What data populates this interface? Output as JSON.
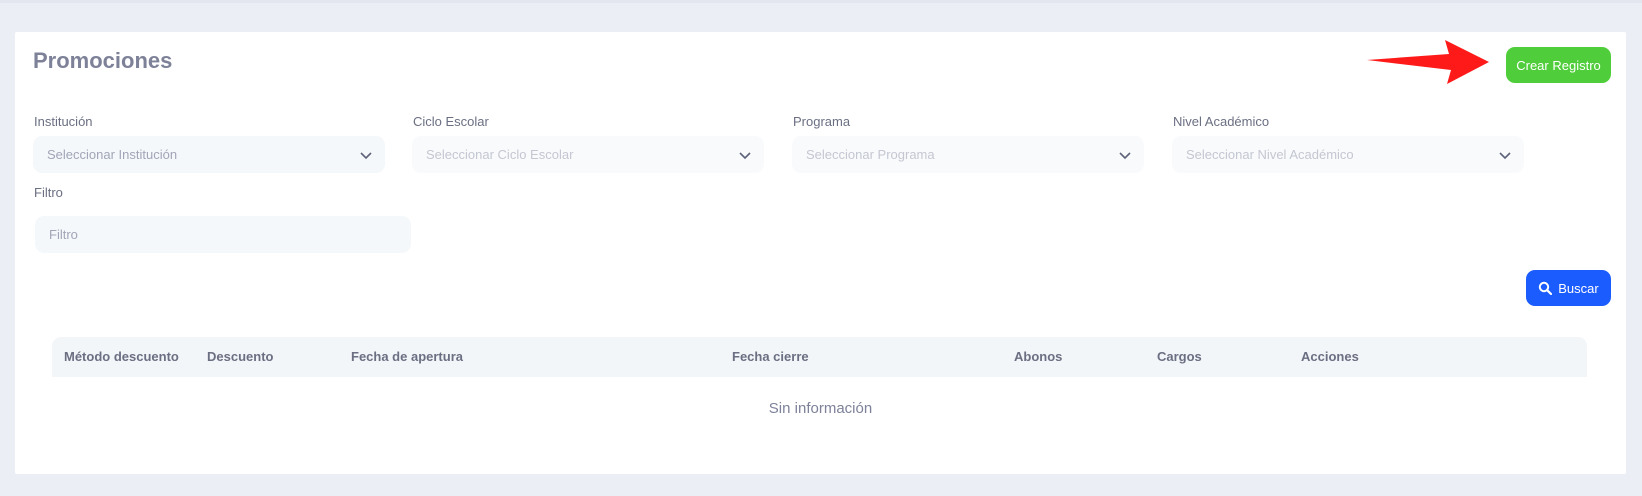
{
  "header": {
    "title": "Promociones",
    "create_label": "Crear Registro"
  },
  "filters": {
    "institucion": {
      "label": "Institución",
      "placeholder": "Seleccionar Institución"
    },
    "ciclo": {
      "label": "Ciclo Escolar",
      "placeholder": "Seleccionar Ciclo Escolar"
    },
    "programa": {
      "label": "Programa",
      "placeholder": "Seleccionar Programa"
    },
    "nivel": {
      "label": "Nivel Académico",
      "placeholder": "Seleccionar Nivel Académico"
    },
    "filtro": {
      "label": "Filtro",
      "placeholder": "Filtro",
      "value": ""
    }
  },
  "search": {
    "label": "Buscar"
  },
  "table": {
    "columns": [
      "Método descuento",
      "Descuento",
      "Fecha de apertura",
      "Fecha cierre",
      "Abonos",
      "Cargos",
      "Acciones"
    ],
    "empty_text": "Sin información"
  },
  "colors": {
    "create_button": "#50cd3a",
    "search_button": "#1b5cff",
    "annotation_arrow": "#ff1a1a"
  },
  "icons": {
    "chevron": "chevron-down-icon",
    "search": "search-icon",
    "annotation": "arrow-icon"
  }
}
